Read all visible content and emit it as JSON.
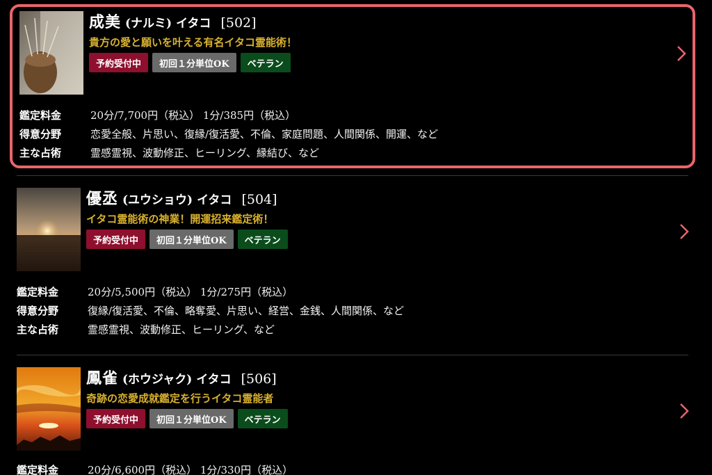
{
  "fortune_tellers": [
    {
      "name": "成美",
      "reading": "(ナルミ)",
      "suffix": "イタコ",
      "code": "[502]",
      "tagline": "貴方の愛と願いを叶える有名イタコ霊能術！",
      "badges": [
        "予約受付中",
        "初回１分単位OK",
        "ベテラン"
      ],
      "labels": {
        "fee": "鑑定料金",
        "specialty": "得意分野",
        "method": "主な占術"
      },
      "fee": "20分/7,700円（税込）  1分/385円（税込）",
      "specialty": "恋愛全般、片思い、復縁/復活愛、不倫、家庭問題、人間関係、開運、など",
      "method": "霊感霊視、波動修正、ヒーリング、縁結び、など",
      "image": "woven-basket-photo",
      "highlighted": true
    },
    {
      "name": "優丞",
      "reading": "(ユウショウ)",
      "suffix": "イタコ",
      "code": "[504]",
      "tagline": "イタコ霊能術の神業！開運招来鑑定術！",
      "badges": [
        "予約受付中",
        "初回１分単位OK",
        "ベテラン"
      ],
      "labels": {
        "fee": "鑑定料金",
        "specialty": "得意分野",
        "method": "主な占術"
      },
      "fee": "20分/5,500円（税込）  1分/275円（税込）",
      "specialty": "復縁/復活愛、不倫、略奪愛、片思い、経営、金銭、人間関係、など",
      "method": "霊感霊視、波動修正、ヒーリング、など",
      "image": "sunset-horizon-photo",
      "highlighted": false
    },
    {
      "name": "鳳雀",
      "reading": "(ホウジャク)",
      "suffix": "イタコ",
      "code": "[506]",
      "tagline": "奇跡の恋愛成就鑑定を行うイタコ霊能者",
      "badges": [
        "予約受付中",
        "初回１分単位OK",
        "ベテラン"
      ],
      "labels": {
        "fee": "鑑定料金"
      },
      "fee": "20分/6,600円（税込）  1分/330円（税込）",
      "image": "orange-sky-sunset-photo",
      "highlighted": false
    }
  ],
  "colors": {
    "highlight_border": "#e9656c",
    "tagline": "#d8b12f",
    "badge_reserve": "#8e0f2e",
    "badge_minute": "#6a6a6a",
    "badge_veteran": "#0b4c1c",
    "chevron": "#e9656c"
  },
  "icons": {
    "detail": "chevron-right-icon"
  }
}
